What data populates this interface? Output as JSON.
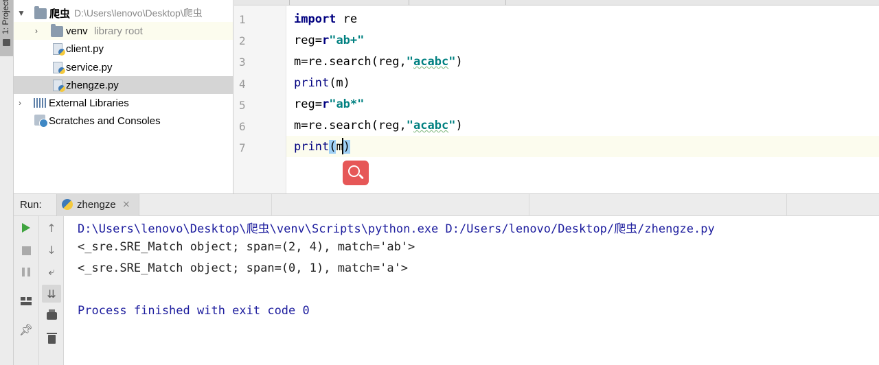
{
  "tool_window_strip": {
    "project_tab_label": "1: Project"
  },
  "project_tree": {
    "items": [
      {
        "name": "爬虫",
        "path": "D:\\Users\\lenovo\\Desktop\\爬虫"
      },
      {
        "name": "venv",
        "sub": "library root"
      },
      {
        "name": "client.py"
      },
      {
        "name": "service.py"
      },
      {
        "name": "zhengze.py"
      },
      {
        "name": "External Libraries"
      },
      {
        "name": "Scratches and Consoles"
      }
    ]
  },
  "editor": {
    "line_numbers": [
      "1",
      "2",
      "3",
      "4",
      "5",
      "6",
      "7"
    ],
    "lines": [
      {
        "kw": "import",
        "rest": " re"
      },
      {
        "a": "reg=",
        "b": "r",
        "c": "\"ab+\""
      },
      {
        "a": "m=re.search(reg,",
        "b": "\"",
        "c": "acabc",
        "d": "\"",
        "e": ")"
      },
      {
        "a": "print",
        "b": "(m)"
      },
      {
        "a": "reg=",
        "b": "r",
        "c": "\"ab*\""
      },
      {
        "a": "m=re.search(reg,",
        "b": "\"",
        "c": "acabc",
        "d": "\"",
        "e": ")"
      },
      {
        "a": "print",
        "b": "(",
        "c": "m",
        "d": ")"
      }
    ]
  },
  "run": {
    "label": "Run:",
    "tab_label": "zhengze",
    "close_glyph": "×",
    "console": [
      "D:\\Users\\lenovo\\Desktop\\爬虫\\venv\\Scripts\\python.exe D:/Users/lenovo/Desktop/爬虫/zhengze.py",
      "<_sre.SRE_Match object; span=(2, 4), match='ab'>",
      "<_sre.SRE_Match object; span=(0, 1), match='a'>",
      "",
      "Process finished with exit code 0"
    ]
  },
  "colors": {
    "keyword": "#000080",
    "string": "#008080",
    "console_path": "#1d1d9e",
    "run_icon": "#3fa43f",
    "search_badge": "#e65757"
  },
  "icons": [
    "folder-icon",
    "python-file-icon",
    "library-icon",
    "scratches-icon",
    "run-icon",
    "stop-icon",
    "pause-icon",
    "up-icon",
    "down-icon",
    "soft-wrap-icon",
    "scroll-to-end-icon",
    "print-icon",
    "layout-icon",
    "pin-icon",
    "trash-icon",
    "search-icon"
  ]
}
